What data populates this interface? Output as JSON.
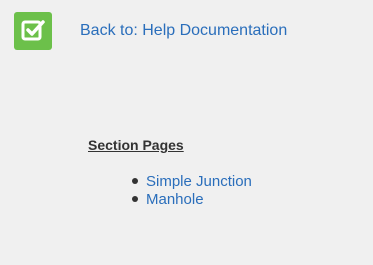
{
  "header": {
    "logo_icon": "checkbox-check-icon",
    "logo_color": "#6cc04a",
    "back_link": "Back to: Help Documentation"
  },
  "section": {
    "title": "Section Pages",
    "pages": [
      {
        "label": "Simple Junction"
      },
      {
        "label": "Manhole"
      }
    ]
  },
  "colors": {
    "link": "#2a6ebb",
    "panel_bg": "#f0f0f0"
  }
}
